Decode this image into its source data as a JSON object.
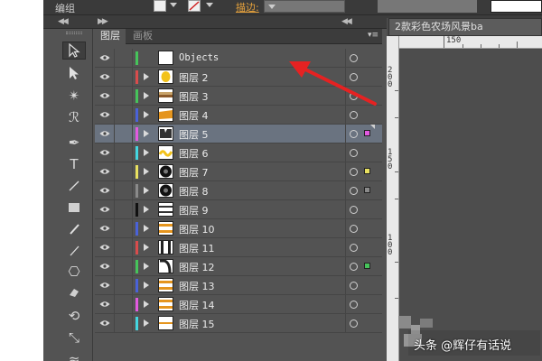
{
  "topbar": {
    "edit_label": "编组",
    "stroke_label": "描边:"
  },
  "layers_panel": {
    "tabs": [
      "图层",
      "画板"
    ],
    "active_tab": 0,
    "rows": [
      {
        "label": "Objects",
        "color": "#46c35a",
        "thumb": "blank",
        "expandable": false,
        "selected": false,
        "selection_color": ""
      },
      {
        "label": "图层 2",
        "color": "#d84c4c",
        "thumb": "yellow-circle",
        "expandable": true,
        "selected": false,
        "selection_color": ""
      },
      {
        "label": "图层 3",
        "color": "#46c35a",
        "thumb": "brown-band",
        "expandable": true,
        "selected": false,
        "selection_color": ""
      },
      {
        "label": "图层 4",
        "color": "#4a62d8",
        "thumb": "orange-band",
        "expandable": true,
        "selected": false,
        "selection_color": ""
      },
      {
        "label": "图层 5",
        "color": "#e25ae0",
        "thumb": "dark-shape",
        "expandable": true,
        "selected": true,
        "selection_color": "#e25ae0"
      },
      {
        "label": "图层 6",
        "color": "#44d6e0",
        "thumb": "yellow-wave",
        "expandable": true,
        "selected": false,
        "selection_color": ""
      },
      {
        "label": "图层 7",
        "color": "#e8e060",
        "thumb": "black-ring",
        "expandable": true,
        "selected": false,
        "selection_color": "#e8e060"
      },
      {
        "label": "图层 8",
        "color": "#8a8a8a",
        "thumb": "black-ring",
        "expandable": true,
        "selected": false,
        "selection_color": "#8a8a8a"
      },
      {
        "label": "图层 9",
        "color": "#111111",
        "thumb": "dark-stripes",
        "expandable": true,
        "selected": false,
        "selection_color": ""
      },
      {
        "label": "图层 10",
        "color": "#4a62d8",
        "thumb": "orange-stripes",
        "expandable": true,
        "selected": false,
        "selection_color": ""
      },
      {
        "label": "图层 11",
        "color": "#d84c4c",
        "thumb": "bars",
        "expandable": true,
        "selected": false,
        "selection_color": ""
      },
      {
        "label": "图层 12",
        "color": "#46c35a",
        "thumb": "curve",
        "expandable": true,
        "selected": false,
        "selection_color": "#46c35a"
      },
      {
        "label": "图层 13",
        "color": "#4a62d8",
        "thumb": "orange-stripes",
        "expandable": true,
        "selected": false,
        "selection_color": ""
      },
      {
        "label": "图层 14",
        "color": "#e25ae0",
        "thumb": "orange-stripes",
        "expandable": true,
        "selected": false,
        "selection_color": ""
      },
      {
        "label": "图层 15",
        "color": "#44d6e0",
        "thumb": "orange-line",
        "expandable": true,
        "selected": false,
        "selection_color": ""
      }
    ]
  },
  "document": {
    "tab_title": "2款彩色农场风景ba",
    "ruler_top_label": "150",
    "ruler_left_labels": [
      "200",
      "150",
      "100"
    ]
  },
  "watermark": "头条 @辉仔有话说"
}
